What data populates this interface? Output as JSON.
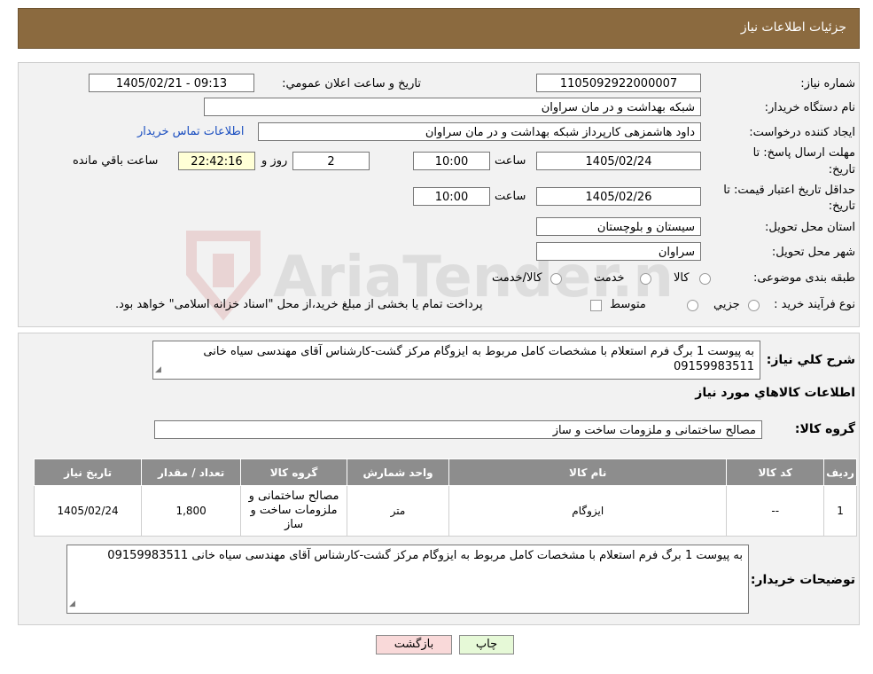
{
  "header": {
    "title": "جزئیات اطلاعات نیاز"
  },
  "watermark": {
    "text": "AriaTender.neT"
  },
  "form": {
    "need_number_label": "شماره نیاز:",
    "need_number": "1105092922000007",
    "announce_label": "تاریخ و ساعت اعلان عمومي:",
    "announce_value": "1405/02/21 - 09:13",
    "buyer_org_label": "نام دستگاه خریدار:",
    "buyer_org": "شبکه بهداشت و در مان سراوان",
    "requester_label": "ایجاد کننده درخواست:",
    "requester": "داود هاشمزهی  کارپرداز شبکه بهداشت و در مان سراوان",
    "contact_link": "اطلاعات تماس خریدار",
    "deadline_label_1": "مهلت ارسال پاسخ: تا",
    "deadline_label_2": "تاریخ:",
    "deadline_date": "1405/02/24",
    "time_label": "ساعت",
    "deadline_time": "10:00",
    "days_value": "2",
    "days_label": "روز و",
    "remaining_time": "22:42:16",
    "remaining_label": "ساعت باقي مانده",
    "validity_label_1": "حداقل تاریخ اعتبار قیمت: تا",
    "validity_label_2": "تاریخ:",
    "validity_date": "1405/02/26",
    "validity_time": "10:00",
    "province_label": "استان محل تحویل:",
    "province": "سیستان و بلوچستان",
    "city_label": "شهر محل تحویل:",
    "city": "سراوان",
    "category_label": "طبقه بندی موضوعی:",
    "category_options": [
      "کالا",
      "خدمت",
      "کالا/خدمت"
    ],
    "process_label": "نوع فرآیند خرید :",
    "process_options": [
      "جزیي",
      "متوسط"
    ],
    "process_note": "پرداخت تمام یا بخشی از مبلغ خرید،از محل \"اسناد خزانه اسلامی\" خواهد بود."
  },
  "summary": {
    "label": "شرح کلي نیاز:",
    "text": "به پیوست 1 برگ فرم استعلام با مشخصات کامل مربوط به ایزوگام مرکز گشت-کارشناس آقای مهندسی سیاه خانی 09159983511"
  },
  "goods_section_title": "اطلاعات کالاهاي مورد نیاز",
  "goods_group": {
    "label": "گروه کالا:",
    "value": "مصالح ساختمانی و ملزومات ساخت و ساز"
  },
  "table": {
    "headers": [
      "ردیف",
      "کد کالا",
      "نام کالا",
      "واحد شمارش",
      "گروه کالا",
      "تعداد / مقدار",
      "تاریخ نیاز"
    ],
    "rows": [
      {
        "row": "1",
        "code": "--",
        "name": "ایزوگام",
        "unit": "متر",
        "group": "مصالح ساختمانی و ملزومات ساخت و ساز",
        "qty": "1,800",
        "date": "1405/02/24"
      }
    ]
  },
  "buyer_notes": {
    "label": "توضیحات خریدار:",
    "text": "به پیوست 1 برگ فرم استعلام با مشخصات کامل مربوط به ایزوگام مرکز گشت-کارشناس آقای مهندسی سیاه خانی 09159983511"
  },
  "buttons": {
    "print": "چاپ",
    "back": "بازگشت"
  },
  "colors": {
    "header_bg": "#8b6a3f",
    "table_header_bg": "#8d8d8d",
    "back_button_bg": "#f9d9d9",
    "print_button_bg": "#e6f9d7"
  }
}
